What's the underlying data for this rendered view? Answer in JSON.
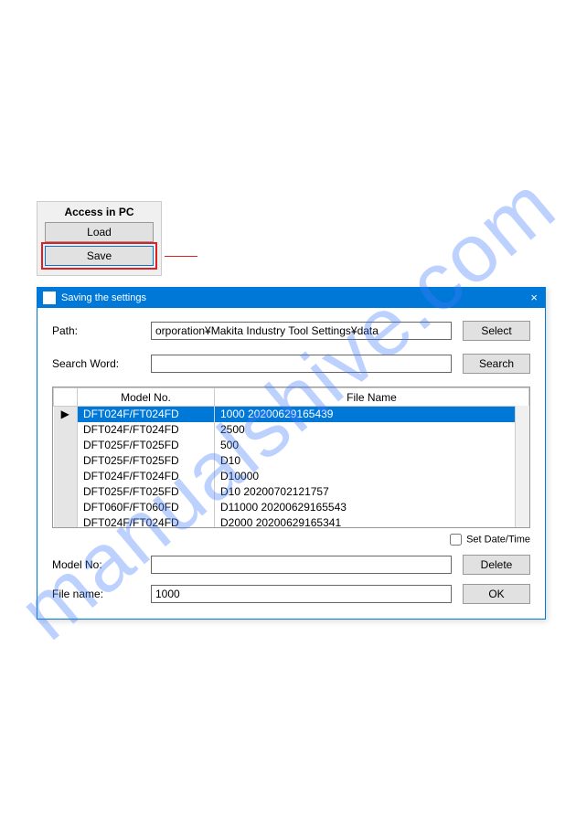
{
  "watermark": "manualshive.com",
  "access_panel": {
    "title": "Access in PC",
    "load_label": "Load",
    "save_label": "Save"
  },
  "dialog": {
    "title": "Saving the settings",
    "path_label": "Path:",
    "path_value": "orporation¥Makita Industry Tool Settings¥data",
    "select_label": "Select",
    "search_label": "Search Word:",
    "search_value": "",
    "search_btn": "Search",
    "columns": {
      "arrow": "",
      "model": "Model No.",
      "file": "File Name"
    },
    "rows": [
      {
        "arrow": "▶",
        "model": "DFT024F/FT024FD",
        "file": "1000 20200629165439",
        "selected": true
      },
      {
        "arrow": "",
        "model": "DFT024F/FT024FD",
        "file": "2500"
      },
      {
        "arrow": "",
        "model": "DFT025F/FT025FD",
        "file": "500"
      },
      {
        "arrow": "",
        "model": "DFT025F/FT025FD",
        "file": "D10"
      },
      {
        "arrow": "",
        "model": "DFT024F/FT024FD",
        "file": "D10000"
      },
      {
        "arrow": "",
        "model": "DFT025F/FT025FD",
        "file": "D10 20200702121757"
      },
      {
        "arrow": "",
        "model": "DFT060F/FT060FD",
        "file": "D11000 20200629165543"
      },
      {
        "arrow": "",
        "model": "DFT024F/FT024FD",
        "file": "D2000 20200629165341"
      }
    ],
    "set_datetime_label": "Set Date/Time",
    "model_label": "Model No:",
    "model_value": "",
    "delete_label": "Delete",
    "filename_label": "File name:",
    "filename_value": "1000",
    "ok_label": "OK"
  }
}
